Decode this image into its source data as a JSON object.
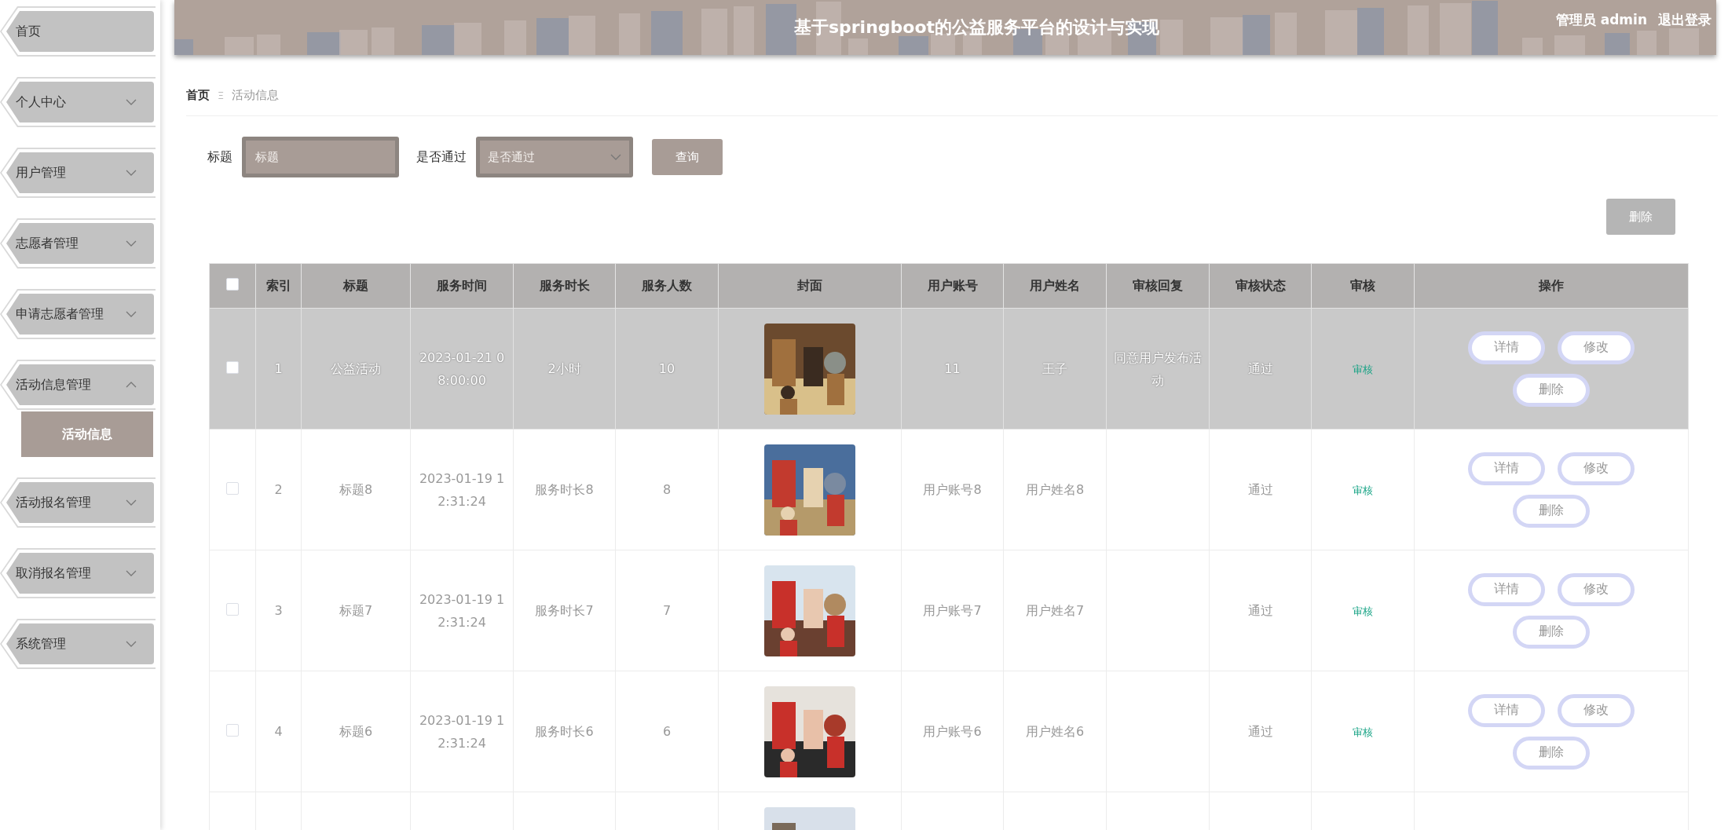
{
  "sidebar": {
    "items": [
      {
        "label": "首页"
      },
      {
        "label": "个人中心",
        "expanded": false
      },
      {
        "label": "用户管理",
        "expanded": false
      },
      {
        "label": "志愿者管理",
        "expanded": false
      },
      {
        "label": "申请志愿者管理",
        "expanded": false
      },
      {
        "label": "活动信息管理",
        "expanded": true,
        "children": [
          {
            "label": "活动信息",
            "selected": true
          }
        ]
      },
      {
        "label": "活动报名管理",
        "expanded": false
      },
      {
        "label": "取消报名管理",
        "expanded": false
      },
      {
        "label": "系统管理",
        "expanded": false
      }
    ]
  },
  "header": {
    "title": "基于springboot的公益服务平台的设计与实现",
    "user": "管理员 admin",
    "logout": "退出登录"
  },
  "breadcrumb": [
    {
      "label": "首页",
      "current": false
    },
    {
      "label": "活动信息",
      "current": true
    }
  ],
  "breadcrumb_separator": "Ξ",
  "search": {
    "fields": [
      {
        "kind": "input",
        "label": "标题",
        "placeholder": "标题"
      },
      {
        "kind": "select",
        "label": "是否通过",
        "placeholder": "是否通过"
      }
    ],
    "button": "查询"
  },
  "delete_button": "删除",
  "table": {
    "columns": [
      "索引",
      "标题",
      "服务时间",
      "服务时长",
      "服务人数",
      "封面",
      "用户账号",
      "用户姓名",
      "审核回复",
      "审核状态",
      "审核",
      "操作"
    ],
    "header_checked": false,
    "rows": [
      {
        "checked": false,
        "highlighted": true,
        "index": "1",
        "title": "公益活动",
        "time": "2023-01-21 08:00:00",
        "duration": "2小时",
        "count": "10",
        "cover": {
          "kind": "picture"
        },
        "account": "11",
        "name": "王子",
        "reply": "同意用户发布活动",
        "status": "通过",
        "review": "审核",
        "actions": [
          "详情",
          "修改",
          "删除"
        ]
      },
      {
        "checked": false,
        "highlighted": false,
        "index": "2",
        "title": "标题8",
        "time": "2023-01-19 12:31:24",
        "duration": "服务时长8",
        "count": "8",
        "cover": {
          "kind": "picture"
        },
        "account": "用户账号8",
        "name": "用户姓名8",
        "status": "通过",
        "review": "审核",
        "actions": [
          "详情",
          "修改",
          "删除"
        ]
      },
      {
        "checked": false,
        "highlighted": false,
        "index": "3",
        "title": "标题7",
        "time": "2023-01-19 12:31:24",
        "duration": "服务时长7",
        "count": "7",
        "cover": {
          "kind": "picture"
        },
        "account": "用户账号7",
        "name": "用户姓名7",
        "status": "通过",
        "review": "审核",
        "actions": [
          "详情",
          "修改",
          "删除"
        ]
      },
      {
        "checked": false,
        "highlighted": false,
        "index": "4",
        "title": "标题6",
        "time": "2023-01-19 12:31:24",
        "duration": "服务时长6",
        "count": "6",
        "cover": {
          "kind": "picture"
        },
        "account": "用户账号6",
        "name": "用户姓名6",
        "status": "通过",
        "review": "审核",
        "actions": [
          "详情",
          "修改",
          "删除"
        ]
      },
      {
        "cover": {
          "kind": "picture"
        }
      }
    ]
  }
}
